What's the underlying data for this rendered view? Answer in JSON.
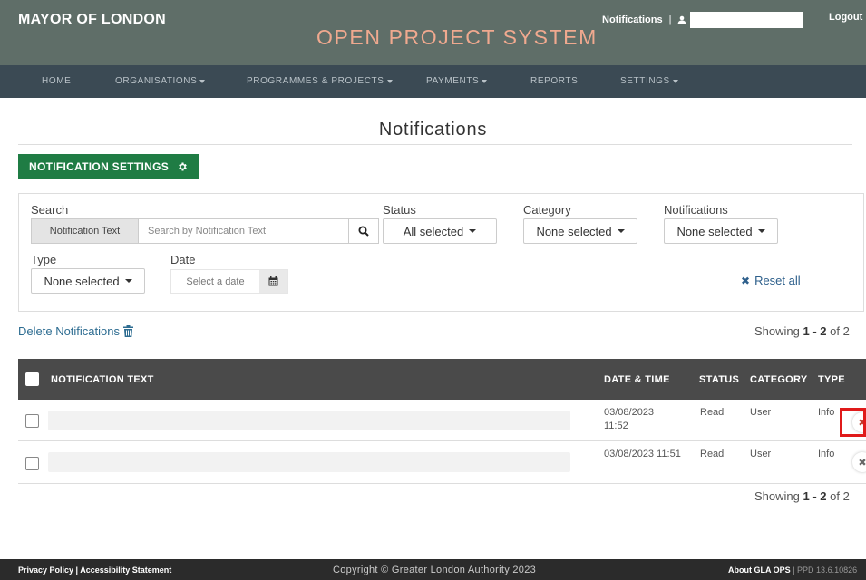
{
  "header": {
    "brand": "MAYOR OF LONDON",
    "system_title": "OPEN PROJECT SYSTEM",
    "notifications_link": "Notifications",
    "separator": "|",
    "logout": "Logout",
    "user_icon": "user-icon"
  },
  "nav": {
    "items": [
      {
        "label": "HOME",
        "dropdown": false
      },
      {
        "label": "ORGANISATIONS",
        "dropdown": true
      },
      {
        "label": "PROGRAMMES & PROJECTS",
        "dropdown": true
      },
      {
        "label": "PAYMENTS",
        "dropdown": true
      },
      {
        "label": "REPORTS",
        "dropdown": false
      },
      {
        "label": "SETTINGS",
        "dropdown": true
      }
    ]
  },
  "page": {
    "title": "Notifications",
    "settings_button": "NOTIFICATION SETTINGS",
    "settings_icon": "gear-icon"
  },
  "filters": {
    "search_label": "Search",
    "search_addon": "Notification Text",
    "search_placeholder": "Search by Notification Text",
    "search_value": "",
    "status_label": "Status",
    "status_value": "All selected",
    "category_label": "Category",
    "category_value": "None selected",
    "notifications_label": "Notifications",
    "notifications_value": "None selected",
    "type_label": "Type",
    "type_value": "None selected",
    "date_label": "Date",
    "date_placeholder": "Select a date",
    "reset_all": "Reset all"
  },
  "actions": {
    "delete_notifications": "Delete Notifications",
    "showing_prefix": "Showing",
    "showing_range": "1 - 2",
    "showing_of": "of",
    "showing_total": "2"
  },
  "table": {
    "columns": {
      "text": "NOTIFICATION TEXT",
      "date": "DATE & TIME",
      "status": "STATUS",
      "category": "CATEGORY",
      "type": "TYPE"
    },
    "rows": [
      {
        "date": "03/08/2023",
        "time": "11:52",
        "status": "Read",
        "category": "User",
        "type": "Info"
      },
      {
        "date": "03/08/2023 11:51",
        "time": "",
        "status": "Read",
        "category": "User",
        "type": "Info"
      }
    ]
  },
  "footer": {
    "left": "Privacy Policy | Accessibility Statement",
    "center": "Copyright © Greater London Authority 2023",
    "right_bold": "About GLA OPS",
    "right_sep": "|",
    "right_version": "PPD 13.6.10826"
  },
  "colors": {
    "header_bg": "#5f6e68",
    "nav_bg": "#3b4a54",
    "system_title": "#f0a98f",
    "primary_green": "#1f7c44",
    "link_blue": "#2d6c91",
    "table_head_bg": "#4a4a4a",
    "highlight_red": "#e01a1a"
  }
}
